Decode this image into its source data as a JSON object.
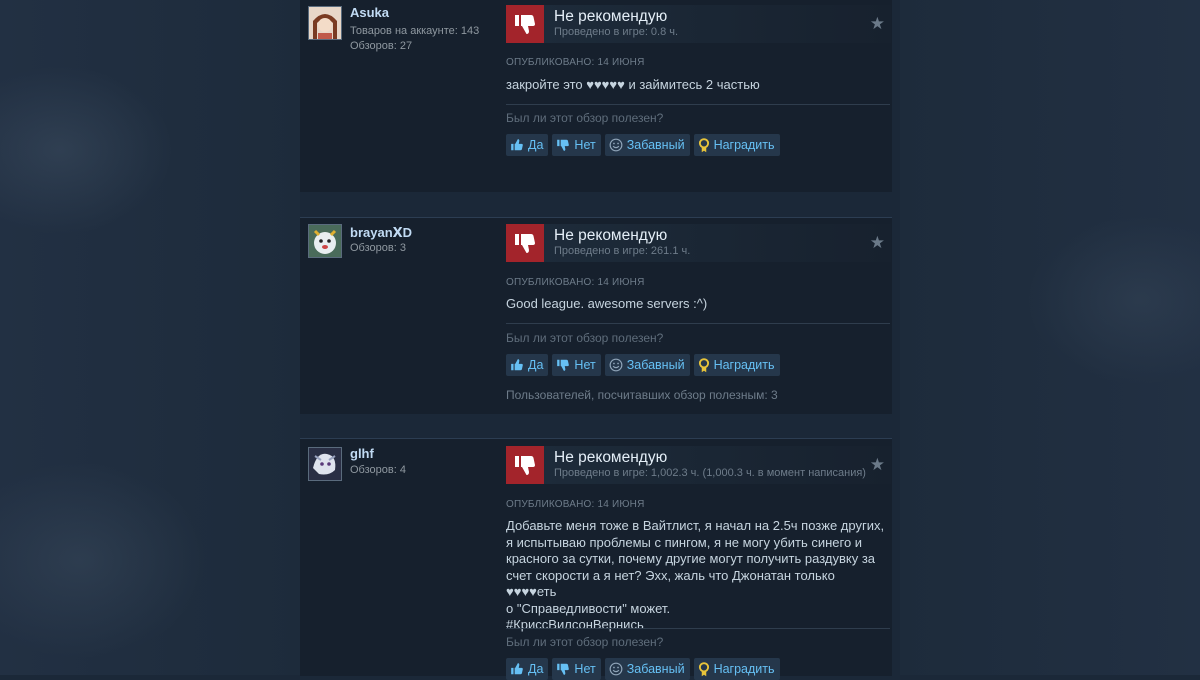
{
  "reviews": [
    {
      "username": "Asuka",
      "meta_lines": [
        "Товаров на аккаунте: 143",
        "Обзоров: 27"
      ],
      "verdict": "Не рекомендую",
      "playtime": "Проведено в игре: 0.8 ч.",
      "posted": "ОПУБЛИКОВАНО: 14 ИЮНЯ",
      "content": "закройте это ♥♥♥♥♥ и займитесь 2 частью",
      "helpful_question": "Был ли этот обзор полезен?",
      "buttons": {
        "yes": "Да",
        "no": "Нет",
        "funny": "Забавный",
        "award": "Наградить"
      },
      "helpful_count": ""
    },
    {
      "username": "brayanⅩD",
      "meta_lines": [
        "Обзоров: 3"
      ],
      "verdict": "Не рекомендую",
      "playtime": "Проведено в игре: 261.1 ч.",
      "posted": "ОПУБЛИКОВАНО: 14 ИЮНЯ",
      "content": "Good league. awesome servers :^)",
      "helpful_question": "Был ли этот обзор полезен?",
      "buttons": {
        "yes": "Да",
        "no": "Нет",
        "funny": "Забавный",
        "award": "Наградить"
      },
      "helpful_count": "Пользователей, посчитавших обзор полезным: 3"
    },
    {
      "username": "glhf",
      "meta_lines": [
        "Обзоров: 4"
      ],
      "verdict": "Не рекомендую",
      "playtime": "Проведено в игре: 1,002.3 ч. (1,000.3 ч. в момент написания)",
      "posted": "ОПУБЛИКОВАНО: 14 ИЮНЯ",
      "content": "Добавьте меня тоже в Вайтлист, я начал на 2.5ч позже других, я испытываю проблемы с пингом, я не могу убить синего и красного за сутки, почему другие могут получить раздувку за счет скорости а я нет? Эхх, жаль что Джонатан только ♥♥♥♥еть о \"Справедливости\" может. #КриссВилсонВернись",
      "content_lines": [
        "Добавьте меня тоже в Вайтлист, я начал на 2.5ч позже других,",
        "я испытываю проблемы с пингом, я не могу убить синего и",
        "красного за сутки, почему другие могут получить раздувку за",
        "счет скорости а я нет? Эхх, жаль что Джонатан только ♥♥♥♥еть",
        "о \"Справедливости\" может.",
        "#КриссВилсонВернись"
      ],
      "helpful_question": "Был ли этот обзор полезен?",
      "buttons": {
        "yes": "Да",
        "no": "Нет",
        "funny": "Забавный",
        "award": "Наградить"
      },
      "helpful_count": ""
    }
  ],
  "colors": {
    "page_bg": "#1b2838",
    "card_bg": "#16202d",
    "not_recommended": "#a3242b",
    "link": "#66c0f4"
  },
  "icons": {
    "thumb_down": "thumbs-down-icon",
    "star": "star-icon",
    "yes": "thumbs-up-icon",
    "no": "thumbs-down-icon",
    "funny": "smiley-icon",
    "award": "award-icon"
  }
}
